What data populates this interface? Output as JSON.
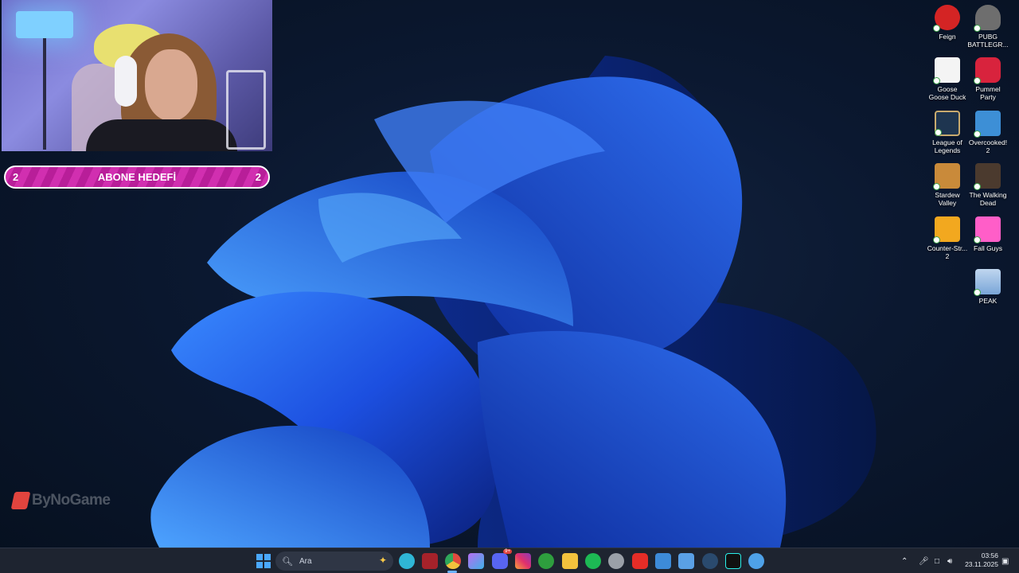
{
  "stream_overlay": {
    "goal_bar": {
      "left_count": "2",
      "title": "ABONE HEDEFİ",
      "right_count": "2"
    },
    "watermark": {
      "text": "ByNoGame"
    }
  },
  "desktop": {
    "icons": [
      {
        "label": "Feign",
        "name": "feign",
        "color": "#d42424"
      },
      {
        "label": "PUBG BATTLEGR...",
        "name": "pubg-battlegrounds",
        "color": "#6e6e6e"
      },
      {
        "label": "Goose Goose Duck",
        "name": "goose-goose-duck",
        "color": "#f4f4f4"
      },
      {
        "label": "Pummel Party",
        "name": "pummel-party",
        "color": "#d8233d"
      },
      {
        "label": "League of Legends",
        "name": "league-of-legends",
        "color": "#1e3550"
      },
      {
        "label": "Overcooked! 2",
        "name": "overcooked-2",
        "color": "#3d8fd6"
      },
      {
        "label": "Stardew Valley",
        "name": "stardew-valley",
        "color": "#c98a3a"
      },
      {
        "label": "The Walking Dead",
        "name": "the-walking-dead",
        "color": "#4b3a2e"
      },
      {
        "label": "Counter-Str... 2",
        "name": "counter-strike-2",
        "color": "#f2a81f"
      },
      {
        "label": "Fall Guys",
        "name": "fall-guys",
        "color": "#ff5ec8"
      },
      {
        "label": "PEAK",
        "name": "peak",
        "color": "#bfd6ef"
      }
    ]
  },
  "taskbar": {
    "search_placeholder": "Ara",
    "pinned": [
      {
        "name": "edge-icon",
        "color": "#2fb6d6"
      },
      {
        "name": "red-app-icon",
        "color": "#a6222a"
      },
      {
        "name": "chrome-icon",
        "color": "#e9b73c"
      },
      {
        "name": "copilot-icon",
        "color": "#b76df2"
      },
      {
        "name": "discord-icon",
        "color": "#5865f2"
      },
      {
        "name": "instagram-icon",
        "color": "#e1306c"
      },
      {
        "name": "xbox-icon",
        "color": "#2e9e3e"
      },
      {
        "name": "file-explorer-icon",
        "color": "#f3c23d"
      },
      {
        "name": "spotify-icon",
        "color": "#1db954"
      },
      {
        "name": "obs-icon",
        "color": "#9aa0a8"
      },
      {
        "name": "youtube-icon",
        "color": "#e52d27"
      },
      {
        "name": "mail-icon",
        "color": "#3d8bd9"
      },
      {
        "name": "notepad-icon",
        "color": "#5aa0e6"
      },
      {
        "name": "steam-icon",
        "color": "#2a4a6e"
      },
      {
        "name": "tiktok-icon",
        "color": "#111111"
      },
      {
        "name": "settings-app-icon",
        "color": "#4ea1e8"
      }
    ],
    "discord_badge": "9+",
    "clock": {
      "time": "03:56",
      "date": "23.11.2025"
    }
  }
}
